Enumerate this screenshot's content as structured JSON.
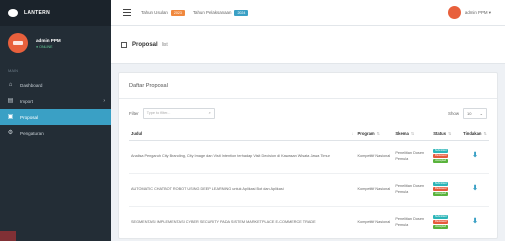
{
  "brand": {
    "name": "LANTERN"
  },
  "user": {
    "name": "admin PPM",
    "status": "● ONLINE"
  },
  "sidebar": {
    "header": "MAIN",
    "items": [
      {
        "label": "Dashboard",
        "icon": "home-icon"
      },
      {
        "label": "Import",
        "icon": "upload-icon"
      },
      {
        "label": "Proposal",
        "icon": "document-icon",
        "active": true
      },
      {
        "label": "Pengaturan",
        "icon": "gear-icon"
      }
    ]
  },
  "topbar": {
    "tahun_usulan": {
      "label": "Tahun Usulan",
      "badge": "2023"
    },
    "tahun_pelaksanaan": {
      "label": "Tahun Pelaksanaan",
      "badge": "2024"
    },
    "user_label": "admin PPM ▾"
  },
  "content_header": {
    "title": "Proposal",
    "subtitle": "list"
  },
  "box": {
    "title": "Daftar Proposal",
    "filter_label": "Filter",
    "filter_placeholder": "Type to filter...",
    "show_label": "Show",
    "show_value": "10"
  },
  "table": {
    "headers": [
      "Judul",
      "Program",
      "Skema",
      "Status",
      "Tindakan"
    ],
    "rows": [
      {
        "judul": "Analisa Pengaruh City Branding, City Image dan Visit Intention terhadap Visit Decision di Kawasan Wisata Jawa Timur",
        "program": "Kompetitif Nasional",
        "skema": "Penelitian Dosen Pemula",
        "status": [
          "Submitted",
          "Reviewed",
          "Accepted"
        ]
      },
      {
        "judul": "AUTOMATIC CHATBOT ROBOT USING DEEP LEARNING untuk Aplikasi Bot dan Aplikasi",
        "program": "Kompetitif Nasional",
        "skema": "Penelitian Dosen Pemula",
        "status": [
          "Submitted",
          "Reviewed",
          "Accepted"
        ]
      },
      {
        "judul": "SEGMENTASI IMPLEMENTASI CYBER SECURITY PADA SISTEM MARKETPLACE E-COMMERCE TRADE",
        "program": "Kompetitif Nasional",
        "skema": "Penelitian Dosen Pemula",
        "status": [
          "Submitted",
          "Reviewed",
          "Accepted"
        ]
      }
    ]
  },
  "colors": {
    "sidebar_bg": "#232d36",
    "active": "#3aa0c5",
    "avatar": "#e8603c",
    "status_teal": "#2bb5b8",
    "status_red": "#e65a3c",
    "status_green": "#59b33c"
  }
}
